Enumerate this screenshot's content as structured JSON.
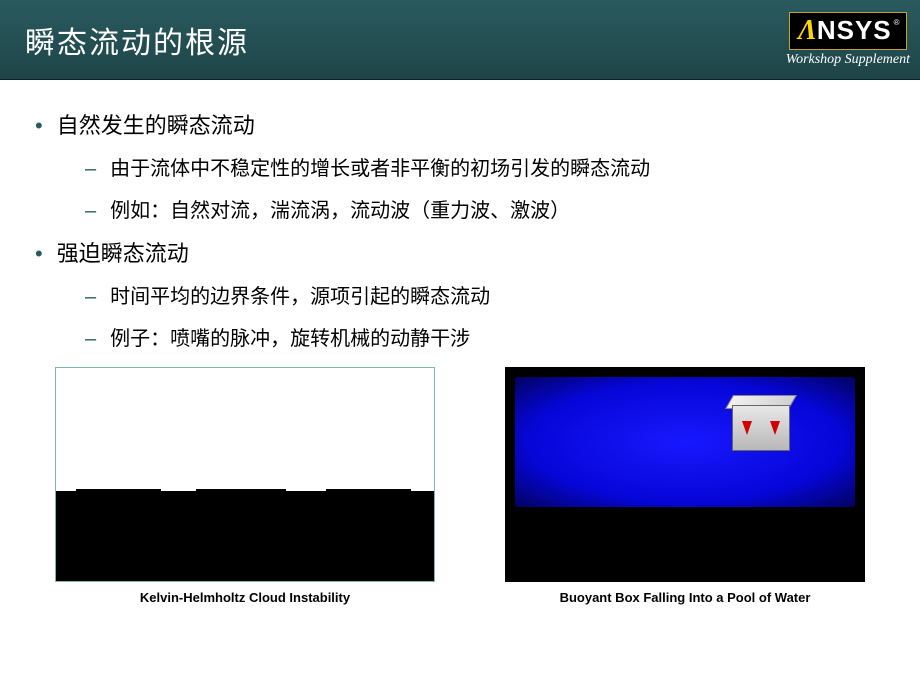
{
  "header": {
    "title": "瞬态流动的根源",
    "logo": {
      "part1": "Λ",
      "part2": "NSYS",
      "reg": "®"
    },
    "supplement": "Workshop Supplement"
  },
  "content": {
    "bullets": [
      {
        "level": 1,
        "text": "自然发生的瞬态流动"
      },
      {
        "level": 2,
        "text": "由于流体中不稳定性的增长或者非平衡的初场引发的瞬态流动"
      },
      {
        "level": 2,
        "text": "例如：自然对流，湍流涡，流动波（重力波、激波）"
      },
      {
        "level": 1,
        "text": "强迫瞬态流动"
      },
      {
        "level": 2,
        "text": "时间平均的边界条件，源项引起的瞬态流动"
      },
      {
        "level": 2,
        "text": "例子：喷嘴的脉冲，旋转机械的动静干涉"
      }
    ]
  },
  "figures": {
    "left_caption": "Kelvin-Helmholtz  Cloud Instability",
    "right_caption": "Buoyant  Box Falling  Into a Pool of Water"
  }
}
